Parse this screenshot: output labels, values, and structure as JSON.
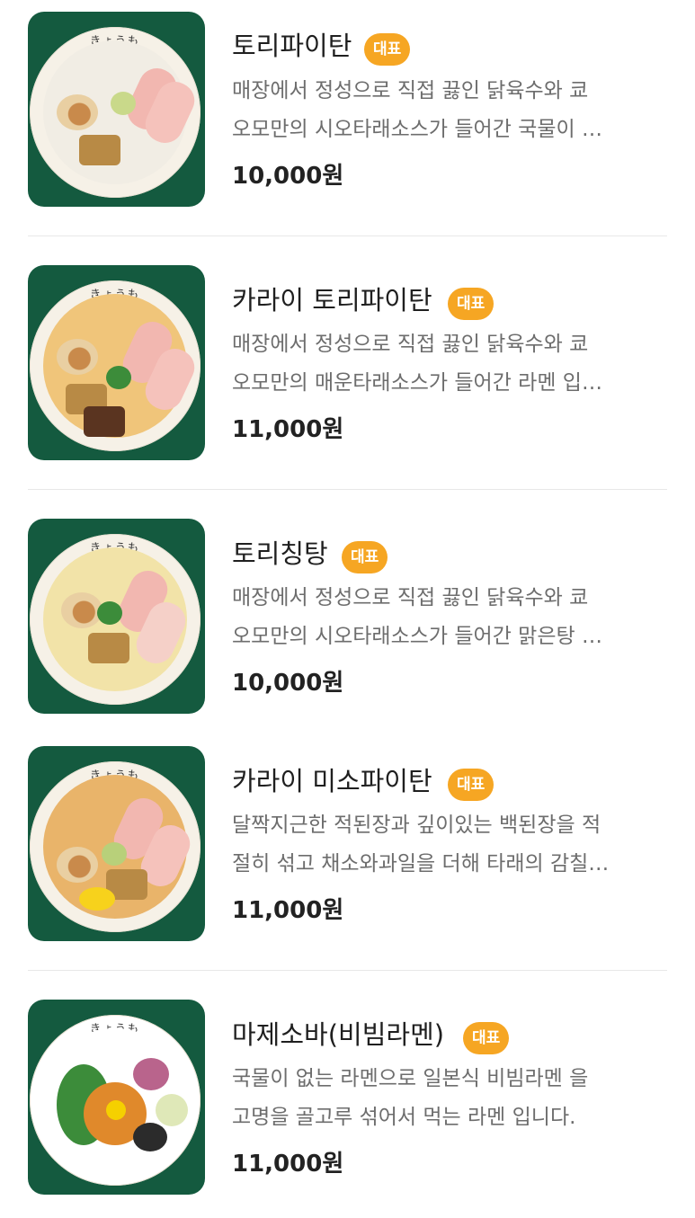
{
  "menu": {
    "badge_label": "대표",
    "items": [
      {
        "name": "토리파이탄",
        "desc_line1": "매장에서 정성으로 직접 끓인 닭육수와 쿄",
        "desc_line2": "오모만의 시오타래소스가 들어간 국물이 …",
        "price": "10,000원",
        "image_icon": "ramen-bowl-thumbnail"
      },
      {
        "name": "카라이 토리파이탄",
        "desc_line1": "매장에서 정성으로 직접 끓인 닭육수와 쿄",
        "desc_line2": "오모만의 매운타래소스가 들어간 라멘 입…",
        "price": "11,000원",
        "image_icon": "spicy-ramen-bowl-thumbnail"
      },
      {
        "name": "토리칭탕",
        "desc_line1": "매장에서 정성으로 직접 끓인 닭육수와 쿄",
        "desc_line2": "오모만의 시오타래소스가 들어간 맑은탕 …",
        "price": "10,000원",
        "image_icon": "clear-ramen-bowl-thumbnail"
      },
      {
        "name": "카라이 미소파이탄",
        "desc_line1": "달짝지근한 적된장과 깊이있는 백된장을 적",
        "desc_line2": "절히 섞고 채소와과일을 더해 타래의 감칠…",
        "price": "11,000원",
        "image_icon": "miso-ramen-bowl-thumbnail"
      },
      {
        "name": "마제소바(비빔라멘)",
        "desc_line1": "국물이 없는 라멘으로 일본식 비빔라멘 을",
        "desc_line2": "고명을 골고루 섞어서 먹는 라멘 입니다.",
        "price": "11,000원",
        "image_icon": "mazesoba-bowl-thumbnail"
      }
    ],
    "bowl_logo_text": "きょうも",
    "colors": {
      "thumb_bg": "#145a3f",
      "badge_bg": "#f6a623",
      "badge_text": "#ffffff",
      "desc_text": "#6d6d6d"
    }
  }
}
